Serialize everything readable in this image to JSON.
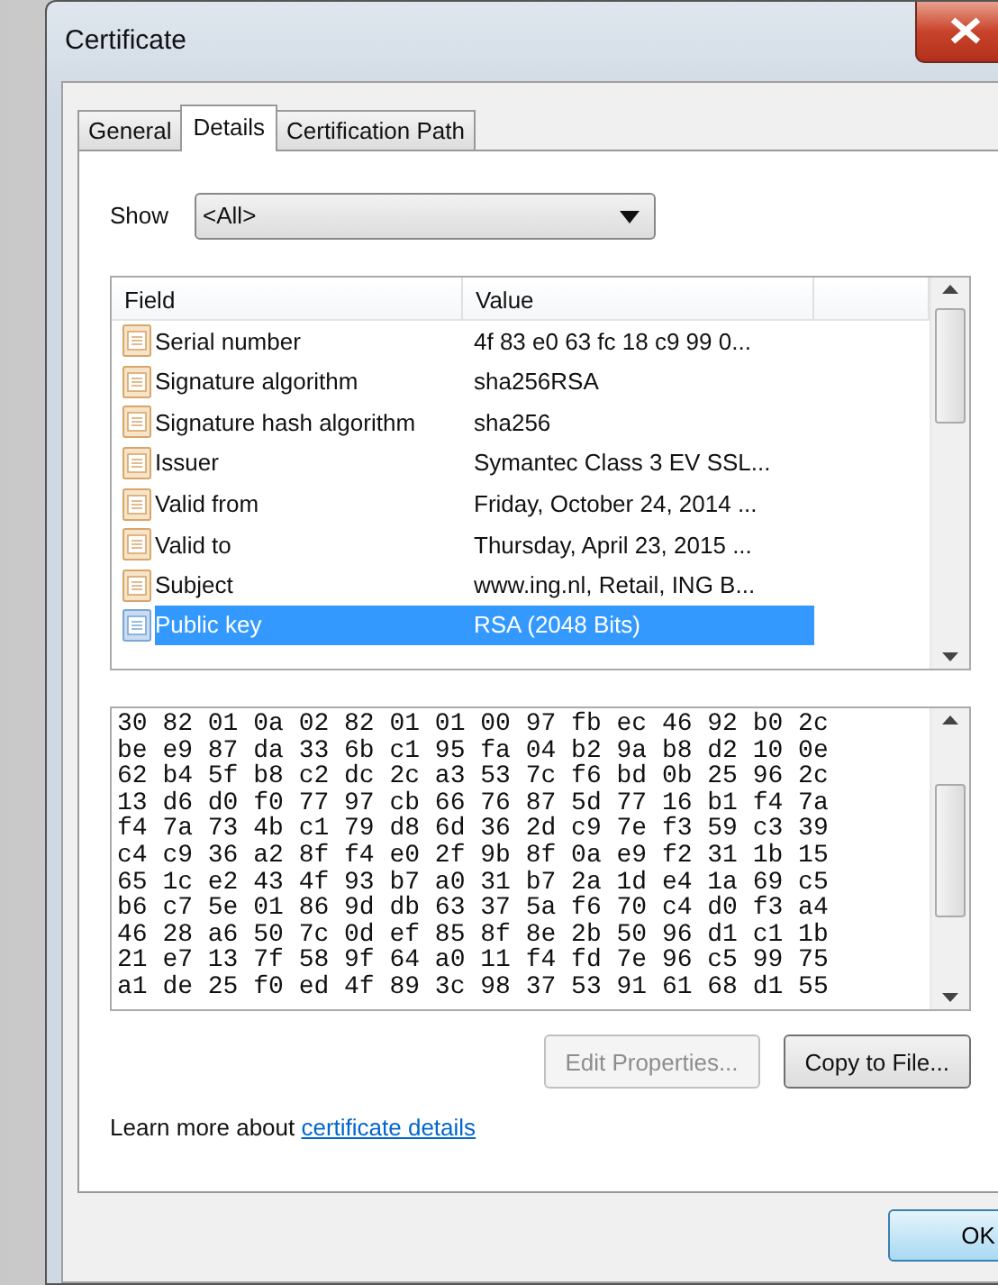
{
  "window": {
    "title": "Certificate"
  },
  "tabs": [
    {
      "label": "General",
      "selected": false
    },
    {
      "label": "Details",
      "selected": true
    },
    {
      "label": "Certification Path",
      "selected": false
    }
  ],
  "show": {
    "label": "Show",
    "value": "<All>"
  },
  "fields": {
    "columns": [
      "Field",
      "Value"
    ],
    "rows": [
      {
        "field": "Serial number",
        "value": "4f 83 e0 63 fc 18 c9 99 0...",
        "selected": false
      },
      {
        "field": "Signature algorithm",
        "value": "sha256RSA",
        "selected": false
      },
      {
        "field": "Signature hash algorithm",
        "value": "sha256",
        "selected": false
      },
      {
        "field": "Issuer",
        "value": "Symantec Class 3 EV SSL...",
        "selected": false
      },
      {
        "field": "Valid from",
        "value": "Friday, October 24, 2014 ...",
        "selected": false
      },
      {
        "field": "Valid to",
        "value": "Thursday, April 23, 2015 ...",
        "selected": false
      },
      {
        "field": "Subject",
        "value": "www.ing.nl, Retail, ING B...",
        "selected": false
      },
      {
        "field": "Public key",
        "value": "RSA (2048 Bits)",
        "selected": true
      }
    ]
  },
  "value_hex": [
    "30 82 01 0a 02 82 01 01 00 97 fb ec 46 92 b0 2c",
    "be e9 87 da 33 6b c1 95 fa 04 b2 9a b8 d2 10 0e",
    "62 b4 5f b8 c2 dc 2c a3 53 7c f6 bd 0b 25 96 2c",
    "13 d6 d0 f0 77 97 cb 66 76 87 5d 77 16 b1 f4 7a",
    "f4 7a 73 4b c1 79 d8 6d 36 2d c9 7e f3 59 c3 39",
    "c4 c9 36 a2 8f f4 e0 2f 9b 8f 0a e9 f2 31 1b 15",
    "65 1c e2 43 4f 93 b7 a0 31 b7 2a 1d e4 1a 69 c5",
    "b6 c7 5e 01 86 9d db 63 37 5a f6 70 c4 d0 f3 a4",
    "46 28 a6 50 7c 0d ef 85 8f 8e 2b 50 96 d1 c1 1b",
    "21 e7 13 7f 58 9f 64 a0 11 f4 fd 7e 96 c5 99 75",
    "a1 de 25 f0 ed 4f 89 3c 98 37 53 91 61 68 d1 55"
  ],
  "buttons": [
    {
      "label": "Edit Properties...",
      "disabled": true
    },
    {
      "label": "Copy to File...",
      "disabled": false
    }
  ],
  "learn_more": {
    "text": "Learn more about",
    "link": "certificate details"
  },
  "ok_button": {
    "label": "OK"
  }
}
